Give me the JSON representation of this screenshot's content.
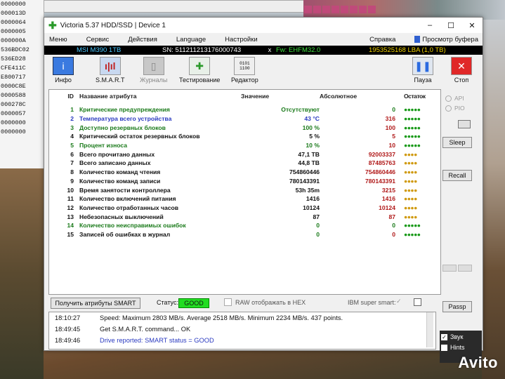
{
  "background": {
    "hex_lines": [
      "0000000",
      "000013D",
      "0000064",
      "0000005",
      "000000A",
      "536BDC02",
      "536ED28",
      "CFE411C",
      "E800717",
      "0000C8E",
      "0000588",
      "000278C",
      "0000057",
      "0000000",
      "0000000"
    ],
    "watermark": "Avito"
  },
  "window": {
    "title": "Victoria 5.37 HDD/SSD | Device 1",
    "controls": {
      "minimize": "–",
      "maximize": "☐",
      "close": "✕"
    }
  },
  "menu": {
    "items": [
      "Меню",
      "Сервис",
      "Действия",
      "Language",
      "Настройки"
    ],
    "help": "Справка",
    "buffer_view": "Просмотр буфера"
  },
  "device": {
    "model": "MSI M390 1TB",
    "serial": "SN: 511211213176000743",
    "close_symbol": "x",
    "firmware": "Fw: EHFM32.0",
    "lba": "1953525168 LBA (1,0 TB)"
  },
  "toolbar": {
    "info": "Инфо",
    "smart": "S.M.A.R.T",
    "journals": "Журналы",
    "testing": "Тестирование",
    "editor": "Редактор",
    "pause": "Пауза",
    "stop": "Стоп"
  },
  "smart": {
    "headers": {
      "id": "ID",
      "name": "Название атрибута",
      "value": "Значение",
      "absolute": "Абсолютное",
      "remain": "Остаток"
    },
    "rows": [
      {
        "id": "1",
        "name": "Критические предупреждения",
        "value": "Отсутствуют",
        "absolute": "0",
        "remain": "●●●●●",
        "name_color": "g",
        "value_color": "g",
        "abs_color": "g",
        "dots": "g"
      },
      {
        "id": "2",
        "name": "Температура всего устройства",
        "value": "43 °C",
        "absolute": "316",
        "remain": "●●●●●",
        "name_color": "b",
        "value_color": "b",
        "abs_color": "r",
        "dots": "g"
      },
      {
        "id": "3",
        "name": "Доступно резервных блоков",
        "value": "100 %",
        "absolute": "100",
        "remain": "●●●●●",
        "name_color": "g",
        "value_color": "g",
        "abs_color": "r",
        "dots": "g"
      },
      {
        "id": "4",
        "name": "Критический остаток резервных блоков",
        "value": "5 %",
        "absolute": "5",
        "remain": "●●●●●",
        "name_color": "k",
        "value_color": "k",
        "abs_color": "r",
        "dots": "g"
      },
      {
        "id": "5",
        "name": "Процент износа",
        "value": "10 %",
        "absolute": "10",
        "remain": "●●●●●",
        "name_color": "g",
        "value_color": "g",
        "abs_color": "r",
        "dots": "g"
      },
      {
        "id": "6",
        "name": "Всего прочитано данных",
        "value": "47,1 TB",
        "absolute": "92003337",
        "remain": "●●●●",
        "name_color": "k",
        "value_color": "k",
        "abs_color": "r",
        "dots": "y"
      },
      {
        "id": "7",
        "name": "Всего записано данных",
        "value": "44,8 TB",
        "absolute": "87485763",
        "remain": "●●●●",
        "name_color": "k",
        "value_color": "k",
        "abs_color": "r",
        "dots": "y"
      },
      {
        "id": "8",
        "name": "Количество команд чтения",
        "value": "754860446",
        "absolute": "754860446",
        "remain": "●●●●",
        "name_color": "k",
        "value_color": "k",
        "abs_color": "r",
        "dots": "y"
      },
      {
        "id": "9",
        "name": "Количество команд записи",
        "value": "780143391",
        "absolute": "780143391",
        "remain": "●●●●",
        "name_color": "k",
        "value_color": "k",
        "abs_color": "r",
        "dots": "y"
      },
      {
        "id": "10",
        "name": "Время занятости контроллера",
        "value": "53h 35m",
        "absolute": "3215",
        "remain": "●●●●",
        "name_color": "k",
        "value_color": "k",
        "abs_color": "r",
        "dots": "y"
      },
      {
        "id": "11",
        "name": "Количество включений питания",
        "value": "1416",
        "absolute": "1416",
        "remain": "●●●●",
        "name_color": "k",
        "value_color": "k",
        "abs_color": "r",
        "dots": "y"
      },
      {
        "id": "12",
        "name": "Количество отработанных часов",
        "value": "10124",
        "absolute": "10124",
        "remain": "●●●●",
        "name_color": "k",
        "value_color": "k",
        "abs_color": "r",
        "dots": "y"
      },
      {
        "id": "13",
        "name": "Небезопасных выключений",
        "value": "87",
        "absolute": "87",
        "remain": "●●●●",
        "name_color": "k",
        "value_color": "k",
        "abs_color": "r",
        "dots": "y"
      },
      {
        "id": "14",
        "name": "Количество неисправимых ошибок",
        "value": "0",
        "absolute": "0",
        "remain": "●●●●●",
        "name_color": "g",
        "value_color": "g",
        "abs_color": "g",
        "dots": "g"
      },
      {
        "id": "15",
        "name": "Записей об ошибках в журнал",
        "value": "0",
        "absolute": "0",
        "remain": "●●●●●",
        "name_color": "k",
        "value_color": "g",
        "abs_color": "r",
        "dots": "g"
      }
    ]
  },
  "status": {
    "get_smart_button": "Получить атрибуты SMART",
    "status_label": "Статус:",
    "status_value": "GOOD",
    "raw_hex": "RAW отображать в HEX",
    "ibm": "IBM super smart:"
  },
  "side": {
    "api": "API",
    "pio": "PIO",
    "sleep": "Sleep",
    "recall": "Recall",
    "passp": "Passp",
    "sound": "Звук",
    "hints": "Hints"
  },
  "log": [
    {
      "time": "18:10:27",
      "msg": "Speed: Maximum 2803 MB/s. Average 2518 MB/s. Minimum 2234 MB/s. 437 points.",
      "color": "#111"
    },
    {
      "time": "18:49:45",
      "msg": "Get S.M.A.R.T. command... OK",
      "color": "#111"
    },
    {
      "time": "18:49:46",
      "msg": "Drive reported: SMART status = GOOD",
      "color": "#2a3ac0"
    }
  ],
  "colors": {
    "good": "#22dd22",
    "accent_blue": "#2a3ac0",
    "green_text": "#1a7a1a",
    "red_text": "#b01818"
  }
}
